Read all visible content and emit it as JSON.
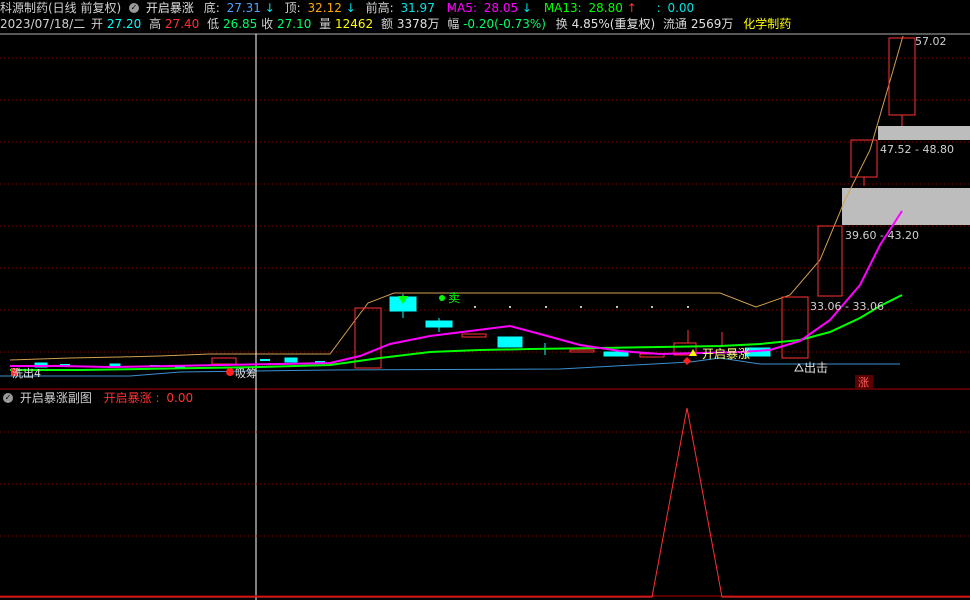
{
  "header": {
    "stock_name": "科源制药(日线 前复权)",
    "indicator_name": "开启暴涨",
    "di_label": "底:",
    "di_value": "27.31",
    "ding_label": "顶:",
    "ding_value": "32.12",
    "qiangao_label": "前高:",
    "qiangao_value": "31.97",
    "ma5_label": "MA5:",
    "ma5_value": "28.05",
    "ma13_label": "MA13:",
    "ma13_value": "28.80",
    "extra_label": ":",
    "extra_value": "0.00"
  },
  "quote": {
    "date": "2023/07/18/二",
    "open_label": "开",
    "open": "27.20",
    "high_label": "高",
    "high": "27.40",
    "low_label": "低",
    "low": "26.85",
    "close_label": "收",
    "close": "27.10",
    "volume_label": "量",
    "volume": "12462",
    "amount_label": "额",
    "amount": "3378万",
    "change_label": "幅",
    "change": "-0.20(-0.73%)",
    "turnover_label": "换",
    "turnover": "4.85%(重复权)",
    "float_label": "流通",
    "float": "2569万",
    "sector": "化学制药"
  },
  "main_chart": {
    "price_peak_label": "57.02",
    "zone_labels": [
      "47.52 - 48.80",
      "39.60 - 43.20",
      "33.06 - 33.06"
    ],
    "sell_label": "卖",
    "signal_label": "开启暴涨",
    "breakout_label": "出击",
    "left_label_1": "洗出4",
    "left_label_2": "吸筹",
    "limit_up_badge": "涨"
  },
  "sub_chart": {
    "title": "开启暴涨副图",
    "series_name": "开启暴涨",
    "series_value": "0.00"
  },
  "colors": {
    "up": "#ff3232",
    "down": "#00ffff",
    "ma5": "#ff00ff",
    "ma13": "#00ff00",
    "grid": "#8b0000",
    "trend": "#d2a050"
  }
}
